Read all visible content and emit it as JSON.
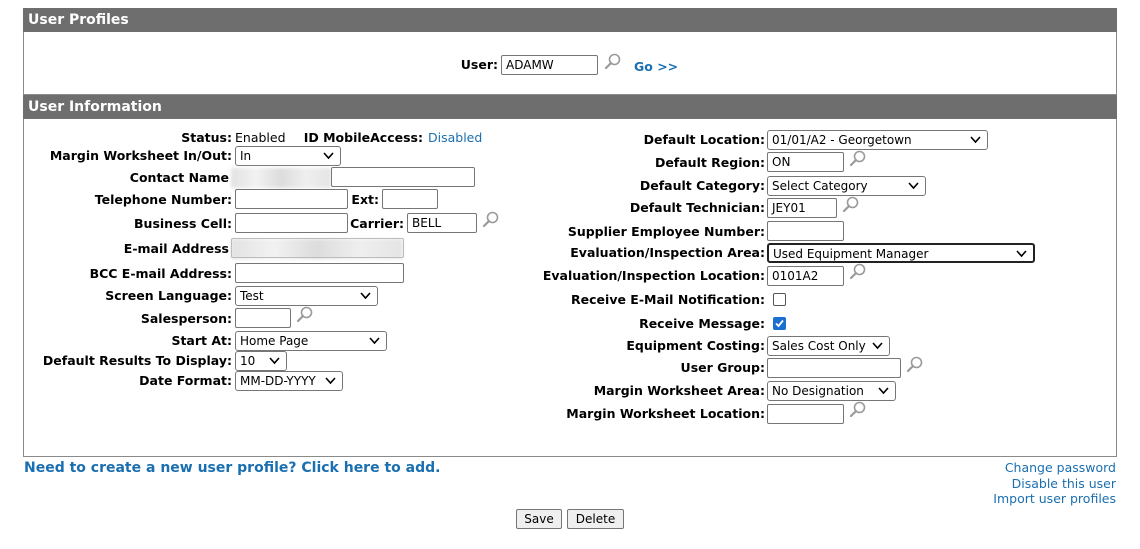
{
  "profiles": {
    "title": "User Profiles",
    "user_label": "User:",
    "user_value": "ADAMW",
    "go_label": "Go >>"
  },
  "info": {
    "title": "User Information",
    "left": {
      "status_label": "Status:",
      "status_value": "Enabled",
      "mobile_label": "ID MobileAccess:",
      "mobile_value": "Disabled",
      "margin_inout_label": "Margin Worksheet In/Out:",
      "margin_inout_value": "In",
      "contact_label": "Contact Name",
      "contact_value": "",
      "telephone_label": "Telephone Number:",
      "telephone_value": "",
      "ext_label": "Ext:",
      "ext_value": "",
      "business_cell_label": "Business Cell:",
      "business_cell_value": "",
      "carrier_label": "Carrier:",
      "carrier_value": "BELL",
      "email_label": "E-mail Address",
      "email_value": "",
      "bcc_label": "BCC E-mail Address:",
      "bcc_value": "",
      "language_label": "Screen Language:",
      "language_value": "Test",
      "salesperson_label": "Salesperson:",
      "salesperson_value": "",
      "start_at_label": "Start At:",
      "start_at_value": "Home Page",
      "results_label": "Default Results To Display:",
      "results_value": "10",
      "date_format_label": "Date Format:",
      "date_format_value": "MM-DD-YYYY"
    },
    "right": {
      "location_label": "Default Location:",
      "location_value": "01/01/A2 - Georgetown",
      "region_label": "Default Region:",
      "region_value": "ON",
      "category_label": "Default Category:",
      "category_value": "Select Category",
      "technician_label": "Default Technician:",
      "technician_value": "JEY01",
      "supplier_label": "Supplier Employee Number:",
      "supplier_value": "",
      "eval_area_label": "Evaluation/Inspection Area:",
      "eval_area_value": "Used Equipment Manager",
      "eval_location_label": "Evaluation/Inspection Location:",
      "eval_location_value": "0101A2",
      "email_notif_label": "Receive E-Mail Notification:",
      "email_notif_checked": false,
      "receive_msg_label": "Receive Message:",
      "receive_msg_checked": true,
      "costing_label": "Equipment Costing:",
      "costing_value": "Sales Cost Only",
      "user_group_label": "User Group:",
      "user_group_value": "",
      "mw_area_label": "Margin Worksheet Area:",
      "mw_area_value": "No Designation",
      "mw_location_label": "Margin Worksheet Location:",
      "mw_location_value": ""
    }
  },
  "footer": {
    "create_link": "Need to create a new user profile? Click here to add.",
    "change_password": "Change password",
    "disable_user": "Disable this user",
    "import_profiles": "Import user profiles",
    "save": "Save",
    "delete": "Delete"
  },
  "icons": {
    "search": "magnifier-icon",
    "dropdown": "chevron-down-icon",
    "check": "checkmark-icon"
  },
  "colors": {
    "header_bg": "#6e6e6e",
    "link": "#1a6fb0",
    "checkbox_checked": "#1a6fd0"
  }
}
